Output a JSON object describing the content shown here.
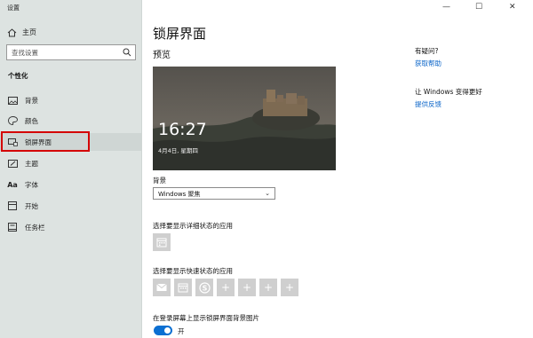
{
  "window": {
    "title": "设置",
    "minimize": "—",
    "maximize": "☐",
    "close": "✕"
  },
  "sidebar": {
    "home": "主页",
    "search_placeholder": "查找设置",
    "section": "个性化",
    "items": [
      {
        "label": "背景",
        "icon": "image-icon"
      },
      {
        "label": "颜色",
        "icon": "palette-icon"
      },
      {
        "label": "锁屏界面",
        "icon": "lock-screen-icon",
        "selected": true
      },
      {
        "label": "主题",
        "icon": "brush-icon"
      },
      {
        "label": "字体",
        "icon": "font-icon"
      },
      {
        "label": "开始",
        "icon": "start-icon"
      },
      {
        "label": "任务栏",
        "icon": "taskbar-icon"
      }
    ]
  },
  "main": {
    "title": "锁屏界面",
    "preview_label": "预览",
    "preview_time": "16:27",
    "preview_date": "4月4日, 星期四",
    "background_label": "背景",
    "background_value": "Windows 聚焦",
    "detail_label": "选择要显示详细状态的应用",
    "quick_label": "选择要显示快速状态的应用",
    "signin_label": "在登录屏幕上显示锁屏界面背景图片",
    "toggle_state": "开"
  },
  "help": {
    "question": "有疑问?",
    "get_help": "获取帮助",
    "improve": "让 Windows 变得更好",
    "feedback": "提供反馈"
  },
  "colors": {
    "accent": "#0b6fd2",
    "highlight": "#d40000",
    "sidebar_bg": "#dde3e1"
  }
}
